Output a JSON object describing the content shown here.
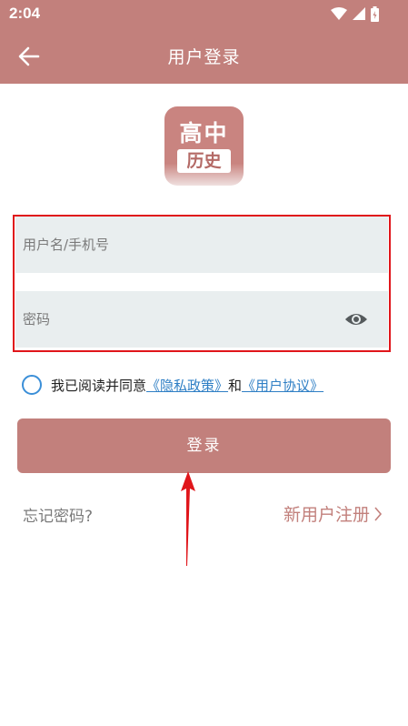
{
  "status_bar": {
    "time": "2:04",
    "icons": [
      "wifi-icon",
      "signal-icon",
      "battery-icon"
    ]
  },
  "app_bar": {
    "title": "用户登录",
    "back_icon": "back-arrow-icon"
  },
  "logo": {
    "line1": "高中",
    "line2": "历史"
  },
  "form": {
    "username": {
      "placeholder": "用户名/手机号",
      "value": ""
    },
    "password": {
      "placeholder": "密码",
      "value": "",
      "toggle_icon": "eye-icon"
    }
  },
  "agreement": {
    "prefix": "我已阅读并同意",
    "privacy_link": "《隐私政策》",
    "conjunction": "和",
    "terms_link": "《用户协议》"
  },
  "login_button": "登录",
  "forgot_password": "忘记密码?",
  "register": "新用户注册",
  "colors": {
    "primary": "#c2807c",
    "highlight": "#e0161b",
    "link": "#2f7fc5",
    "field_bg": "#e9eeef"
  }
}
